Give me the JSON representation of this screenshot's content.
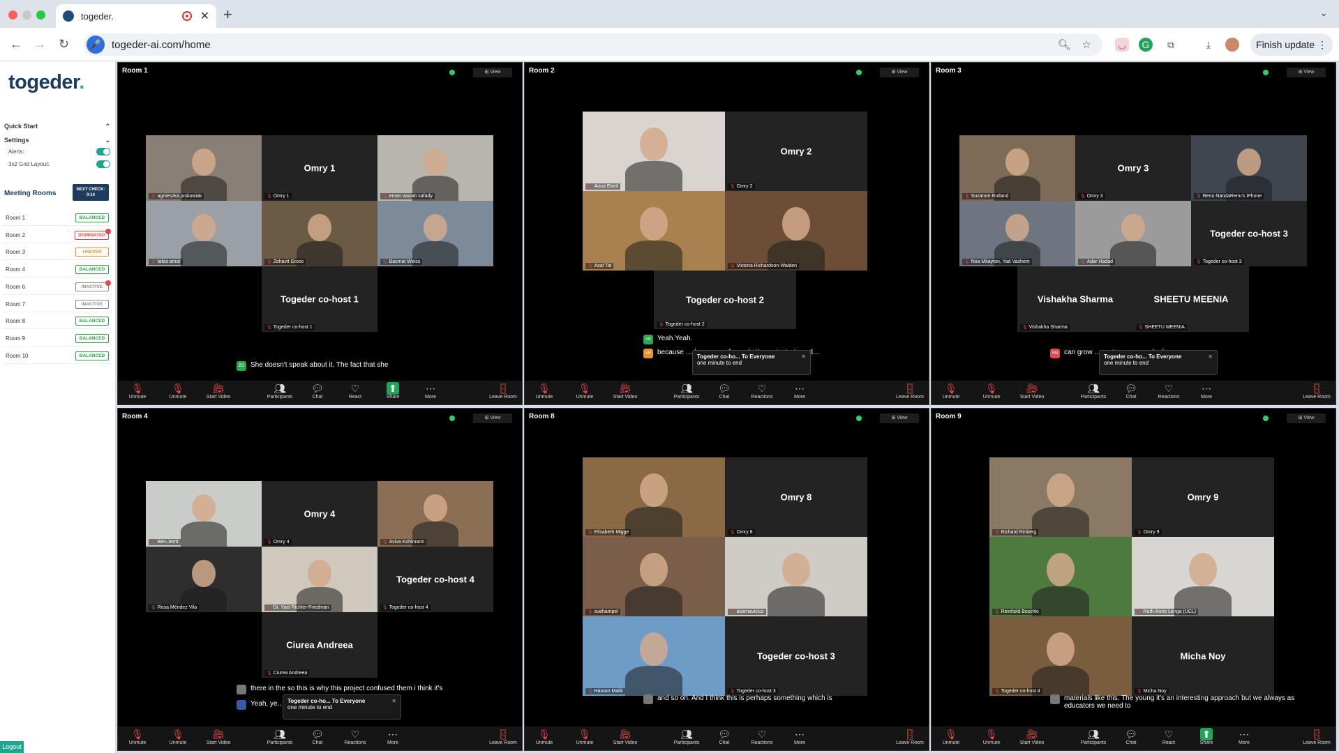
{
  "browser": {
    "tab_title": "togeder.",
    "url": "togeder-ai.com/home",
    "update_button": "Finish update ⋮"
  },
  "sidebar": {
    "logo_text": "togeder",
    "logo_dot": ".",
    "quick_start": "Quick Start",
    "settings": "Settings",
    "alerts_label": "Alerts:",
    "grid_label": "3x2 Grid Layout:",
    "meeting_rooms": "Meeting Rooms",
    "next_check": "NEXT CHECK: 0:14",
    "logout": "Logout",
    "rooms": [
      {
        "name": "Room 1",
        "status": "BALANCED",
        "color": "#2aa84a",
        "alert": false
      },
      {
        "name": "Room 2",
        "status": "DOMINATED",
        "color": "#e54848",
        "alert": true
      },
      {
        "name": "Room 3",
        "status": "UNEVEN",
        "color": "#e8932b",
        "alert": false
      },
      {
        "name": "Room 4",
        "status": "BALANCED",
        "color": "#2aa84a",
        "alert": false
      },
      {
        "name": "Room 6",
        "status": "INACTIVE",
        "color": "#888888",
        "alert": true
      },
      {
        "name": "Room 7",
        "status": "INACTIVE",
        "color": "#888888",
        "alert": false
      },
      {
        "name": "Room 8",
        "status": "BALANCED",
        "color": "#2aa84a",
        "alert": false
      },
      {
        "name": "Room 9",
        "status": "BALANCED",
        "color": "#2aa84a",
        "alert": false
      },
      {
        "name": "Room 10",
        "status": "BALANCED",
        "color": "#2aa84a",
        "alert": false
      }
    ]
  },
  "rooms": [
    {
      "title": "Room 1",
      "view": "⊞ View",
      "tiles": [
        {
          "label": "agnieszka.juskowiak",
          "photo": "#8a7f77"
        },
        {
          "label": "Omry 1",
          "big": "Omry 1"
        },
        {
          "label": "eman wasab safady",
          "photo": "#b8b5ad"
        },
        {
          "label": "talea amar",
          "photo": "#9aa0a6"
        },
        {
          "label": "Zehavit Gross",
          "photo": "#6b5a44",
          "hl": true
        },
        {
          "label": "Basmat Weiss",
          "photo": "#7c8a9a"
        },
        {
          "label": "Togeder co-host 1",
          "big": "Togeder co-host 1"
        }
      ],
      "chat": [
        {
          "initials": "ZG",
          "color": "#2aa84a",
          "text": "She doesn't speak about it. The fact that she"
        }
      ],
      "controls": [
        "Unmute",
        "Unmute",
        "Start Video",
        "Participants",
        "Chat",
        "React",
        "Share",
        "More",
        "Leave Room"
      ]
    },
    {
      "title": "Room 2",
      "view": "⊞ View",
      "tiles": [
        {
          "label": "Anna Eberl",
          "photo": "#d9d4cf"
        },
        {
          "label": "Omry 2",
          "big": "Omry 2"
        },
        {
          "label": "Asaf Tal",
          "photo": "#a8814f"
        },
        {
          "label": "Victoria Richardson-Walden",
          "photo": "#6b4e35",
          "hl": true
        },
        {
          "label": "Togeder co-host 2",
          "big": "Togeder co-host 2"
        }
      ],
      "chat": [
        {
          "initials": "AE",
          "color": "#2aa84a",
          "text": "Yeah.Yeah."
        },
        {
          "initials": "VR",
          "color": "#e8932b",
          "text": "because … have any of one rhyth… minute to end…"
        }
      ],
      "toast": {
        "title": "Togeder co-ho... To Everyone",
        "body": "one minute to end"
      },
      "controls": [
        "Unmute",
        "Unmute",
        "Start Video",
        "Participants",
        "Chat",
        "Reactions",
        "More",
        "Leave Room"
      ]
    },
    {
      "title": "Room 3",
      "view": "⊞ View",
      "tiles": [
        {
          "label": "Suzanne Rutland",
          "photo": "#7d6a57"
        },
        {
          "label": "Omry 3",
          "big": "Omry 3"
        },
        {
          "label": "Renu NandaRenu's iPhone",
          "photo": "#3f4650",
          "hl": true
        },
        {
          "label": "Noa Mkayton, Yad Vashem",
          "photo": "#6d7680"
        },
        {
          "label": "Adar Hadad",
          "photo": "#9b9b9b"
        },
        {
          "label": "Togeder co-host 3",
          "big": "Togeder co-host 3"
        },
        {
          "label": "Vishakha Sharma",
          "big": "Vishakha Sharma"
        },
        {
          "label": "SHEETU MEENIA",
          "big": "SHEETU MEENIA"
        }
      ],
      "chat": [
        {
          "initials": "RN",
          "color": "#e54848",
          "text": "can grow … ve to worry much ab…"
        }
      ],
      "toast": {
        "title": "Togeder co-ho... To Everyone",
        "body": "one minute to end"
      },
      "controls": [
        "Unmute",
        "Unmute",
        "Start Video",
        "Participants",
        "Chat",
        "Reactions",
        "More",
        "Leave Room"
      ]
    },
    {
      "title": "Room 4",
      "view": "⊞ View",
      "tiles": [
        {
          "label": "Ben.Jerrit",
          "photo": "#c9ccc8"
        },
        {
          "label": "Omry 4",
          "big": "Omry 4"
        },
        {
          "label": "Aviva Kohlmann",
          "photo": "#8a6f55"
        },
        {
          "label": "Rosa Méndez Vila",
          "photo": "#2e2e2e",
          "hl": true
        },
        {
          "label": "Dr. Yael Richler-Friedman",
          "photo": "#cfc8bd"
        },
        {
          "label": "Togeder co-host 4",
          "big": "Togeder co-host 4"
        },
        {
          "label": "Ciurea Andreea",
          "big": "Ciurea Andreea"
        }
      ],
      "chat": [
        {
          "initials": "",
          "color": "#777777",
          "text": "there in the so this is why this project confused them i think it's"
        },
        {
          "initials": "",
          "color": "#3a5aa8",
          "text": "Yeah, ye…"
        }
      ],
      "toast": {
        "title": "Togeder co-ho... To Everyone",
        "body": "one minute to end"
      },
      "controls": [
        "Unmute",
        "Unmute",
        "Start Video",
        "Participants",
        "Chat",
        "Reactions",
        "More",
        "Leave Room"
      ]
    },
    {
      "title": "Room 8",
      "view": "⊞ View",
      "tiles": [
        {
          "label": "Elisabeth Migge",
          "photo": "#8a6a45",
          "hl": true
        },
        {
          "label": "Omry 8",
          "big": "Omry 8"
        },
        {
          "label": "suehampel",
          "photo": "#7a5e4a"
        },
        {
          "label": "asarnavicius",
          "photo": "#cfcbc5"
        },
        {
          "label": "Haroon Malik",
          "photo": "#6d9cc7"
        },
        {
          "label": "Togeder co-host 3",
          "big": "Togeder co-host 3"
        }
      ],
      "chat": [
        {
          "initials": "",
          "color": "#777777",
          "text": "and so on. And I think this is perhaps something which is"
        }
      ],
      "controls": [
        "Unmute",
        "Unmute",
        "Start Video",
        "Participants",
        "Chat",
        "Reactions",
        "More",
        "Leave Room"
      ]
    },
    {
      "title": "Room 9",
      "view": "⊞ View",
      "tiles": [
        {
          "label": "Richard Rinberg",
          "photo": "#8a7a63"
        },
        {
          "label": "Omry 9",
          "big": "Omry 9"
        },
        {
          "label": "Reinhold Boschki",
          "photo": "#4f7a3e",
          "hl": true
        },
        {
          "label": "Ruth-Anne Lenga (UCL)",
          "photo": "#d8d6d2"
        },
        {
          "label": "Togeder co-host 4",
          "photo": "#7a5d3f"
        },
        {
          "label": "Micha Noy",
          "big": "Micha Noy"
        }
      ],
      "chat": [
        {
          "initials": "",
          "color": "#777777",
          "text": "materials like this. The young it's an interesting approach but we always as educators we need to"
        }
      ],
      "controls": [
        "Unmute",
        "Unmute",
        "Start Video",
        "Participants",
        "Chat",
        "React",
        "Share",
        "More",
        "Leave Room"
      ]
    }
  ]
}
